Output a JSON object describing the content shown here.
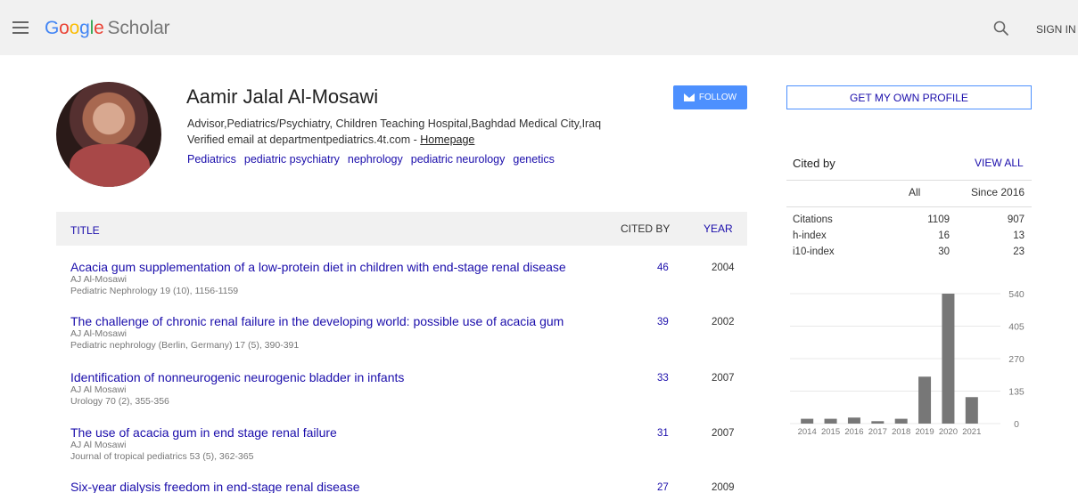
{
  "header": {
    "logo_parts": [
      "G",
      "o",
      "o",
      "g",
      "l",
      "e"
    ],
    "logo_suffix": "Scholar",
    "signin": "SIGN IN"
  },
  "profile": {
    "name": "Aamir Jalal Al-Mosawi",
    "affiliation": "Advisor,Pediatrics/Psychiatry, Children Teaching Hospital,Baghdad Medical City,Iraq",
    "email_text": "Verified email at departmentpediatrics.4t.com - ",
    "homepage": "Homepage",
    "interests": [
      "Pediatrics",
      "pediatric psychiatry",
      "nephrology",
      "pediatric neurology",
      "genetics"
    ],
    "follow_label": "FOLLOW"
  },
  "table": {
    "col_title": "TITLE",
    "col_cited": "CITED BY",
    "col_year": "YEAR",
    "rows": [
      {
        "title": "Acacia gum supplementation of a low-protein diet in children with end-stage renal disease",
        "authors": "AJ Al-Mosawi",
        "venue": "Pediatric Nephrology 19 (10), 1156-1159",
        "cited": "46",
        "year": "2004"
      },
      {
        "title": "The challenge of chronic renal failure in the developing world: possible use of acacia gum",
        "authors": "AJ Al-Mosawi",
        "venue": "Pediatric nephrology (Berlin, Germany) 17 (5), 390-391",
        "cited": "39",
        "year": "2002"
      },
      {
        "title": "Identification of nonneurogenic neurogenic bladder in infants",
        "authors": "AJ Al Mosawi",
        "venue": "Urology 70 (2), 355-356",
        "cited": "33",
        "year": "2007"
      },
      {
        "title": "The use of acacia gum in end stage renal failure",
        "authors": "AJ Al Mosawi",
        "venue": "Journal of tropical pediatrics 53 (5), 362-365",
        "cited": "31",
        "year": "2007"
      },
      {
        "title": "Six-year dialysis freedom in end-stage renal disease",
        "authors": "",
        "venue": "",
        "cited": "27",
        "year": "2009"
      }
    ]
  },
  "sidebar": {
    "own_profile": "GET MY OWN PROFILE",
    "cited_by": "Cited by",
    "view_all": "VIEW ALL",
    "col_all": "All",
    "col_since": "Since 2016",
    "stats": [
      {
        "label": "Citations",
        "all": "1109",
        "since": "907"
      },
      {
        "label": "h-index",
        "all": "16",
        "since": "13"
      },
      {
        "label": "i10-index",
        "all": "30",
        "since": "23"
      }
    ]
  },
  "chart_data": {
    "type": "bar",
    "categories": [
      "2014",
      "2015",
      "2016",
      "2017",
      "2018",
      "2019",
      "2020",
      "2021"
    ],
    "values": [
      20,
      20,
      25,
      10,
      20,
      195,
      540,
      110
    ],
    "y_ticks": [
      "0",
      "135",
      "270",
      "405",
      "540"
    ],
    "ylim": [
      0,
      540
    ],
    "grid": true,
    "bar_color": "#777777"
  }
}
